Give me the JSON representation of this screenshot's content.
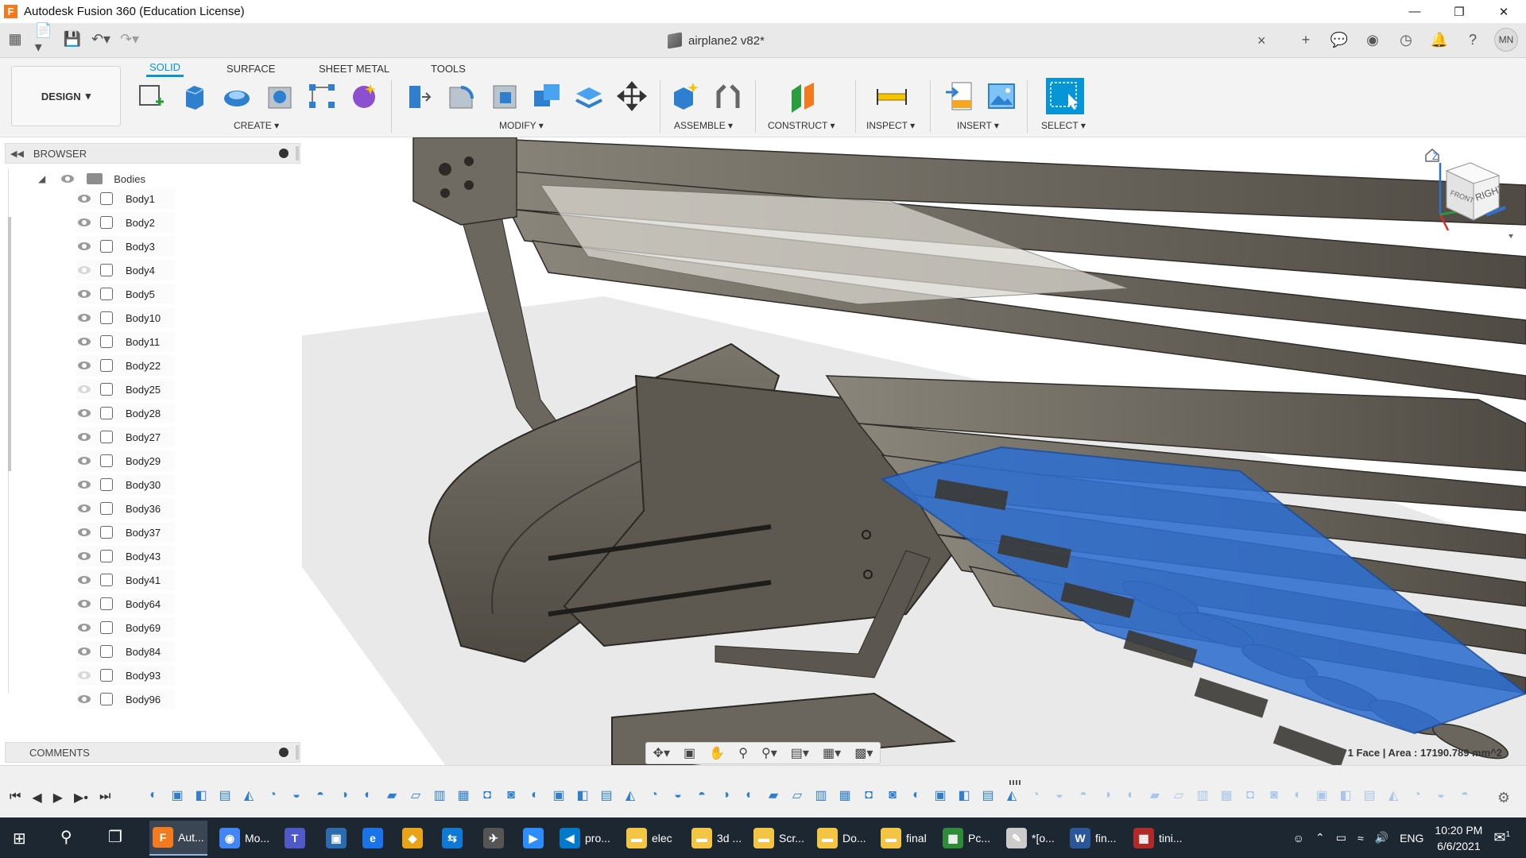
{
  "window": {
    "title": "Autodesk Fusion 360 (Education License)",
    "logo": "F"
  },
  "document": {
    "name": "airplane2 v82*",
    "close": "×"
  },
  "user": {
    "initials": "MN"
  },
  "workspace": {
    "label": "DESIGN"
  },
  "ribbon": {
    "tabs": [
      "SOLID",
      "SURFACE",
      "SHEET METAL",
      "TOOLS"
    ],
    "groups": {
      "create": "CREATE",
      "modify": "MODIFY",
      "assemble": "ASSEMBLE",
      "construct": "CONSTRUCT",
      "inspect": "INSPECT",
      "insert": "INSERT",
      "select": "SELECT"
    },
    "caret": "▾"
  },
  "browser": {
    "title": "BROWSER",
    "root": "Bodies",
    "items": [
      {
        "name": "Body1",
        "visible": true
      },
      {
        "name": "Body2",
        "visible": true
      },
      {
        "name": "Body3",
        "visible": true
      },
      {
        "name": "Body4",
        "visible": false
      },
      {
        "name": "Body5",
        "visible": true
      },
      {
        "name": "Body10",
        "visible": true
      },
      {
        "name": "Body11",
        "visible": true
      },
      {
        "name": "Body22",
        "visible": true
      },
      {
        "name": "Body25",
        "visible": false
      },
      {
        "name": "Body28",
        "visible": true
      },
      {
        "name": "Body27",
        "visible": true
      },
      {
        "name": "Body29",
        "visible": true
      },
      {
        "name": "Body30",
        "visible": true
      },
      {
        "name": "Body36",
        "visible": true
      },
      {
        "name": "Body37",
        "visible": true
      },
      {
        "name": "Body43",
        "visible": true
      },
      {
        "name": "Body41",
        "visible": true
      },
      {
        "name": "Body64",
        "visible": true
      },
      {
        "name": "Body69",
        "visible": true
      },
      {
        "name": "Body84",
        "visible": true
      },
      {
        "name": "Body93",
        "visible": false
      },
      {
        "name": "Body96",
        "visible": true
      }
    ]
  },
  "comments": {
    "title": "COMMENTS"
  },
  "viewcube": {
    "face": "RIGHT",
    "front": "FRONT",
    "axis": "Z"
  },
  "status": {
    "text": "1 Face | Area : 17190.789 mm^2"
  },
  "taskbar": {
    "items": [
      {
        "label": "Aut...",
        "icon": "F",
        "color": "#f37b1d"
      },
      {
        "label": "Mo...",
        "icon": "◉",
        "color": "#4285f4"
      },
      {
        "label": "",
        "icon": "T",
        "color": "#5059c9"
      },
      {
        "label": "",
        "icon": "▣",
        "color": "#2b6cb0"
      },
      {
        "label": "",
        "icon": "e",
        "color": "#1a73e8"
      },
      {
        "label": "",
        "icon": "◆",
        "color": "#e8a317"
      },
      {
        "label": "",
        "icon": "⇆",
        "color": "#0e7ad6"
      },
      {
        "label": "",
        "icon": "✈",
        "color": "#555555"
      },
      {
        "label": "",
        "icon": "▶",
        "color": "#2d8cff"
      },
      {
        "label": "pro...",
        "icon": "◀",
        "color": "#007acc"
      },
      {
        "label": "elec",
        "icon": "▬",
        "color": "#f4c542"
      },
      {
        "label": "3d ...",
        "icon": "▬",
        "color": "#f4c542"
      },
      {
        "label": "Scr...",
        "icon": "▬",
        "color": "#f4c542"
      },
      {
        "label": "Do...",
        "icon": "▬",
        "color": "#f4c542"
      },
      {
        "label": "final",
        "icon": "▬",
        "color": "#f4c542"
      },
      {
        "label": "Pc...",
        "icon": "▦",
        "color": "#2e8b3a"
      },
      {
        "label": "*[o...",
        "icon": "✎",
        "color": "#cccccc"
      },
      {
        "label": "fin...",
        "icon": "W",
        "color": "#2b579a"
      },
      {
        "label": "tini...",
        "icon": "▦",
        "color": "#b02a2a"
      }
    ],
    "tray": {
      "lang": "ENG",
      "time": "10:20 PM",
      "date": "6/6/2021",
      "notifications": "1"
    }
  }
}
